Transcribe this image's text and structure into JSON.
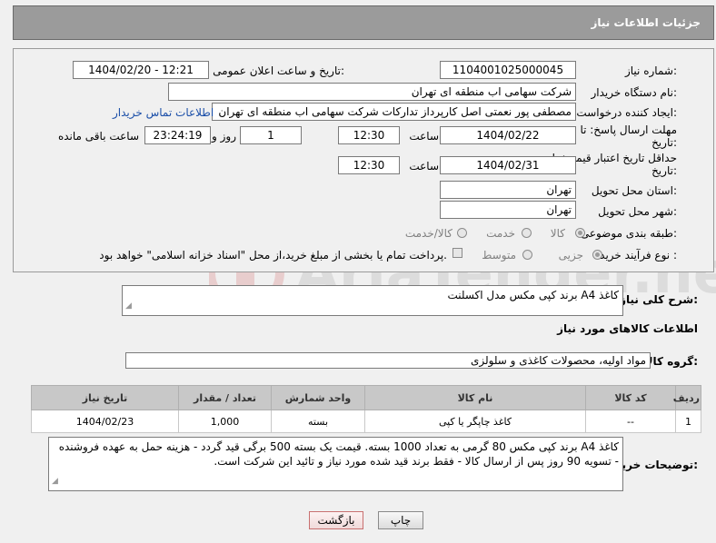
{
  "title": "جزئیات اطلاعات نیاز",
  "form": {
    "need_number_label": "شماره نیاز:",
    "need_number": "1104001025000045",
    "announce_label": "تاریخ و ساعت اعلان عمومی:",
    "announce_value": "1404/02/20 - 12:21",
    "buyer_org_label": "نام دستگاه خریدار:",
    "buyer_org": "شرکت سهامی اب منطقه ای تهران",
    "creator_label": "ایجاد کننده درخواست:",
    "creator": "مصطفی پور نعمتی اصل کارپرداز تدارکات شرکت سهامی اب منطقه ای تهران",
    "contact_link": "اطلاعات تماس خریدار",
    "reply_deadline_label": "مهلت ارسال پاسخ: تا تاریخ:",
    "reply_date": "1404/02/22",
    "time_label": "ساعت",
    "reply_time": "12:30",
    "days_value": "1",
    "days_label": "روز و",
    "remaining_time": "23:24:19",
    "remaining_label": "ساعت باقی مانده",
    "validity_label": "حداقل تاریخ اعتبار قیمت: تا تاریخ:",
    "validity_date": "1404/02/31",
    "validity_time": "12:30",
    "province_label": "استان محل تحویل:",
    "province": "تهران",
    "city_label": "شهر محل تحویل:",
    "city": "تهران",
    "category_label": "طبقه بندی موضوعی:",
    "category_options": [
      "کالا",
      "خدمت",
      "کالا/خدمت"
    ],
    "process_label": "نوع فرآیند خرید :",
    "process_options": [
      "جزیی",
      "متوسط"
    ],
    "payment_note": "پرداخت تمام یا بخشی از مبلغ خرید،از محل \"اسناد خزانه اسلامی\" خواهد بود."
  },
  "description": {
    "label": "شرح کلی نیاز:",
    "value": "کاغذ A4 برند کپی مکس مدل اکسلنت"
  },
  "goods_info_title": "اطلاعات کالاهای مورد نیاز",
  "goods_group": {
    "label": "گروه کالا:",
    "value": "مواد اولیه، محصولات کاغذی و سلولزی"
  },
  "table": {
    "headers": [
      "ردیف",
      "کد کالا",
      "نام کالا",
      "واحد شمارش",
      "تعداد / مقدار",
      "تاریخ نیاز"
    ],
    "rows": [
      [
        "1",
        "--",
        "کاغذ چاپگر یا کپی",
        "بسته",
        "1,000",
        "1404/02/23"
      ]
    ]
  },
  "buyer_notes": {
    "label": "توضیحات خریدار:",
    "value": "کاغذ A4 برند کپی مکس 80 گرمی به تعداد 1000 بسته. قیمت یک بسته 500 برگی قید گردد - هزینه حمل به عهده فروشنده - تسویه 90 روز پس از ارسال کالا - فقط برند قید شده مورد نیاز و تائید این شرکت است."
  },
  "buttons": {
    "print": "چاپ",
    "back": "بازگشت"
  },
  "colors": {
    "header_bg": "#9b9b9b",
    "link": "#1a4ea8",
    "back_border": "#c87070"
  }
}
